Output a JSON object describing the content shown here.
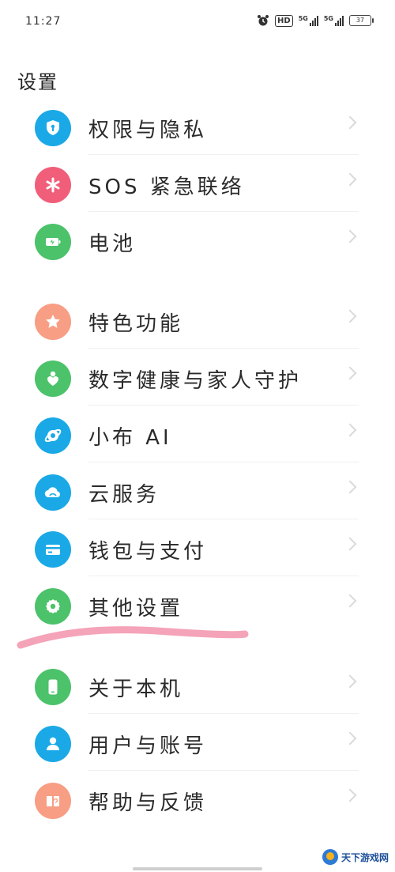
{
  "status_bar": {
    "time": "11:27",
    "hd_label": "HD",
    "signal1_label": "5G",
    "signal2_label": "5G",
    "battery_level": "37"
  },
  "header": {
    "title": "设置"
  },
  "settings_items": [
    {
      "label": "权限与隐私",
      "icon": "shield-lock-icon",
      "color": "#1aa9e6"
    },
    {
      "label": "SOS 紧急联络",
      "icon": "asterisk-icon",
      "color": "#f05e7a"
    },
    {
      "label": "电池",
      "icon": "battery-icon",
      "color": "#4cc26a"
    },
    {
      "label": "特色功能",
      "icon": "star-icon",
      "color": "#f79e84"
    },
    {
      "label": "数字健康与家人守护",
      "icon": "heart-person-icon",
      "color": "#4cc26a"
    },
    {
      "label": "小布 AI",
      "icon": "ai-assistant-icon",
      "color": "#1aa9e6"
    },
    {
      "label": "云服务",
      "icon": "cloud-icon",
      "color": "#1aa9e6"
    },
    {
      "label": "钱包与支付",
      "icon": "wallet-icon",
      "color": "#1aa9e6"
    },
    {
      "label": "其他设置",
      "icon": "gear-icon",
      "color": "#4cc26a"
    },
    {
      "label": "关于本机",
      "icon": "phone-icon",
      "color": "#4cc26a"
    },
    {
      "label": "用户与账号",
      "icon": "user-icon",
      "color": "#1aa9e6"
    },
    {
      "label": "帮助与反馈",
      "icon": "help-book-icon",
      "color": "#f79e84"
    }
  ],
  "annotation_color": "#f4a3b8",
  "watermark": {
    "text": "天下游戏网"
  }
}
